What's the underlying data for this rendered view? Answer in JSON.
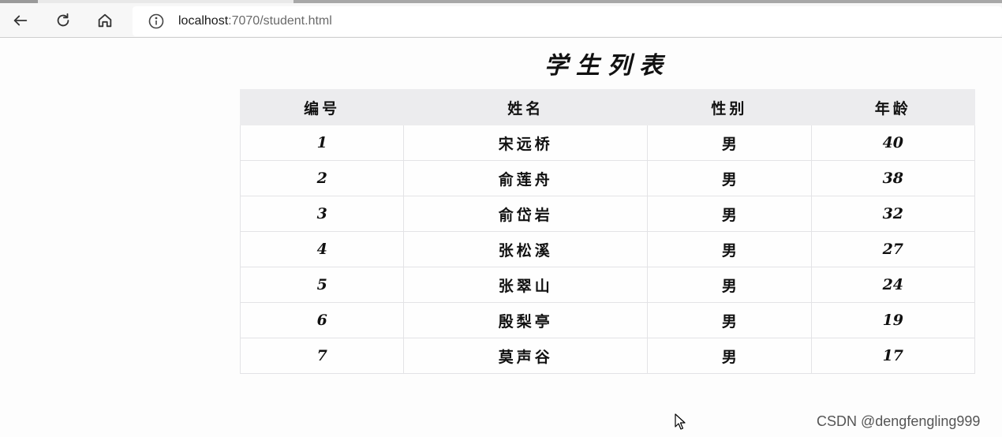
{
  "browser": {
    "url_host": "localhost",
    "url_rest": ":7070/student.html",
    "icons": [
      "back-arrow-icon",
      "reload-icon",
      "home-icon",
      "info-icon"
    ]
  },
  "page": {
    "title": "学生列表",
    "table": {
      "headers": [
        "编号",
        "姓名",
        "性别",
        "年龄"
      ],
      "rows": [
        [
          "1",
          "宋远桥",
          "男",
          "40"
        ],
        [
          "2",
          "俞莲舟",
          "男",
          "38"
        ],
        [
          "3",
          "俞岱岩",
          "男",
          "32"
        ],
        [
          "4",
          "张松溪",
          "男",
          "27"
        ],
        [
          "5",
          "张翠山",
          "男",
          "24"
        ],
        [
          "6",
          "殷梨亭",
          "男",
          "19"
        ],
        [
          "7",
          "莫声谷",
          "男",
          "17"
        ]
      ]
    }
  },
  "watermark": "CSDN @dengfengling999",
  "colors": {
    "header_bg": "#ececee",
    "toolbar_bg": "#f7f7f7"
  }
}
